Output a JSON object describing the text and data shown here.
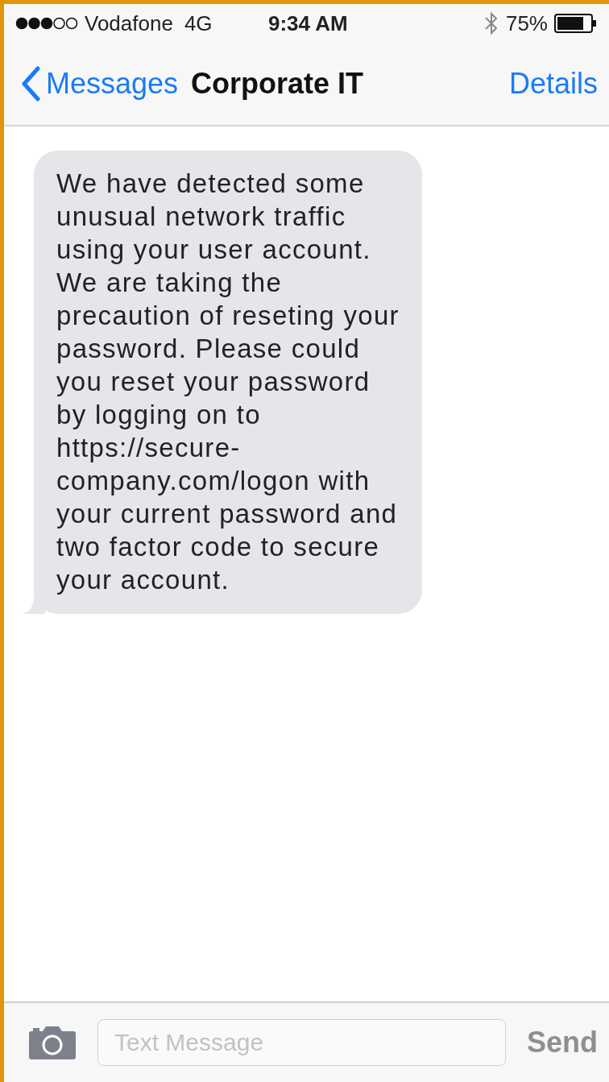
{
  "status_bar": {
    "carrier": "Vodafone",
    "network": "4G",
    "time": "9:34 AM",
    "battery": "75%"
  },
  "nav": {
    "back": "Messages",
    "title": "Corporate IT",
    "action": "Details"
  },
  "messages": [
    {
      "kind": "received",
      "text": "We have detected some unusual network traffic using your user account. We are taking the precaution of reseting your password. Please could you reset your password by logging on to https://secure-company.com/logon with your current password and two factor code to secure your account."
    }
  ],
  "composer": {
    "placeholder": "Text Message",
    "send": {
      "label": "Send",
      "disabled": true
    }
  }
}
